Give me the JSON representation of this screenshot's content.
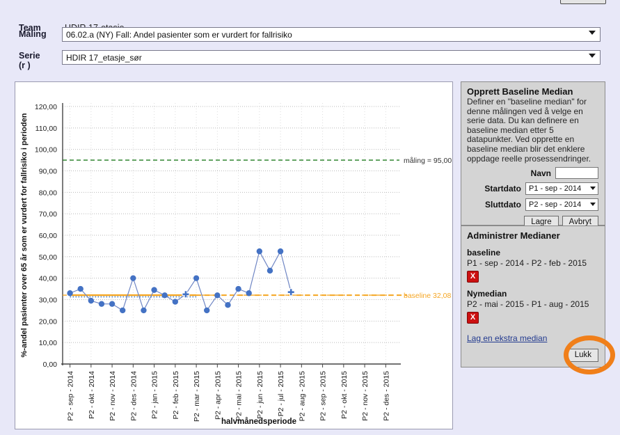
{
  "form": {
    "team_label": "Team",
    "team_value": "HDIR 17-etasje",
    "maling_label": "Måling",
    "maling_value": "06.02.a (NY) Fall: Andel pasienter som er vurdert for fallrisiko",
    "serie_label": "Serie (r )",
    "serie_label_line1": "Serie",
    "serie_label_line2": "(r )",
    "serie_value": "HDIR 17_etasje_sør"
  },
  "baseline_panel": {
    "title": "Opprett Baseline Median",
    "description": "Definer en \"baseline median\" for denne målingen ved å velge en serie data. Du kan definere en baseline median etter 5 datapunkter. Ved opprette en baseline median blir det enklere oppdage reelle prosessendringer.",
    "navn_label": "Navn",
    "navn_value": "",
    "navn_placeholder": "",
    "startdato_label": "Startdato",
    "startdato_value": "P1 - sep - 2014",
    "sluttdato_label": "Sluttdato",
    "sluttdato_value": "P2 - sep - 2014",
    "save_label": "Lagre",
    "cancel_label": "Avbryt"
  },
  "medianer_panel": {
    "title": "Administrer Medianer",
    "medians": [
      {
        "name": "baseline",
        "range": "P1 - sep - 2014 - P2 - feb - 2015",
        "delete_glyph": "X"
      },
      {
        "name": "Nymedian",
        "range": "P2 - mai - 2015 - P1 - aug - 2015",
        "delete_glyph": "X"
      }
    ],
    "extra_link": "Lag en ekstra median",
    "close_label": "Lukk"
  },
  "highlight_color": "#f07f1a",
  "chart_data": {
    "type": "line",
    "title": "",
    "xlabel": "halvmånedsperiode",
    "ylabel": "%-andel pasienter over 65 år som er vurdert for fallrisiko i perioden",
    "ylim": [
      0,
      120
    ],
    "ytick_labels": [
      "0,00",
      "10,00",
      "20,00",
      "30,00",
      "40,00",
      "50,00",
      "60,00",
      "70,00",
      "80,00",
      "90,00",
      "100,00",
      "110,00",
      "120,00"
    ],
    "ytick_values": [
      0,
      10,
      20,
      30,
      40,
      50,
      60,
      70,
      80,
      90,
      100,
      110,
      120
    ],
    "grid": true,
    "legend_position": "none",
    "xtick_labels": [
      "P2 - sep - 2014",
      "P2 - okt - 2014",
      "P2 - nov - 2014",
      "P2 - des - 2014",
      "P2 - jan - 2015",
      "P2 - feb - 2015",
      "P2 - mar - 2015",
      "P2 - apr - 2015",
      "P2 - mai - 2015",
      "P2 - jun - 2015",
      "P2 - jul - 2015",
      "P2 - aug - 2015",
      "P2 - sep - 2015",
      "P2 - okt - 2015",
      "P2 - nov - 2015",
      "P2 - des - 2015"
    ],
    "series": [
      {
        "name": "HDIR 17_etasje_sør",
        "color": "#4472c4",
        "x": [
          0,
          0.5,
          1,
          1.5,
          2,
          2.5,
          3,
          3.5,
          4,
          4.5,
          5,
          5.5,
          6,
          6.5,
          7,
          7.5,
          8,
          8.5,
          9,
          9.5,
          10,
          10.5,
          11
        ],
        "values": [
          33.0,
          35.0,
          29.5,
          28.0,
          28.0,
          25.0,
          40.0,
          25.0,
          34.5,
          32.0,
          29.0,
          32.5,
          40.0,
          25.0,
          32.0,
          27.5,
          35.0,
          33.0,
          52.5,
          43.5,
          52.5,
          33.5
        ]
      }
    ],
    "reference_lines": [
      {
        "name": "måling",
        "label": "måling = 95,00",
        "value": 95.0,
        "color": "#1f7a1f",
        "style": "dashed"
      },
      {
        "name": "baseline",
        "label": "baseline 32,08",
        "value": 32.08,
        "color": "#f5a623",
        "style": "dashed"
      }
    ],
    "median_segments": [
      {
        "name": "baseline-solid",
        "value": 32.08,
        "x_from": 0,
        "x_to": 6.0,
        "color": "#f5a623",
        "style": "solid"
      },
      {
        "name": "baseline-dotted-blue",
        "value": 31.3,
        "x_from": 0,
        "x_to": 6.0,
        "color": "#5b8fd4",
        "style": "dotted"
      },
      {
        "name": "nymedian-dashed",
        "value": 32.08,
        "x_from": 6.0,
        "x_to": 16,
        "color": "#f5a623",
        "style": "dashed"
      }
    ]
  }
}
